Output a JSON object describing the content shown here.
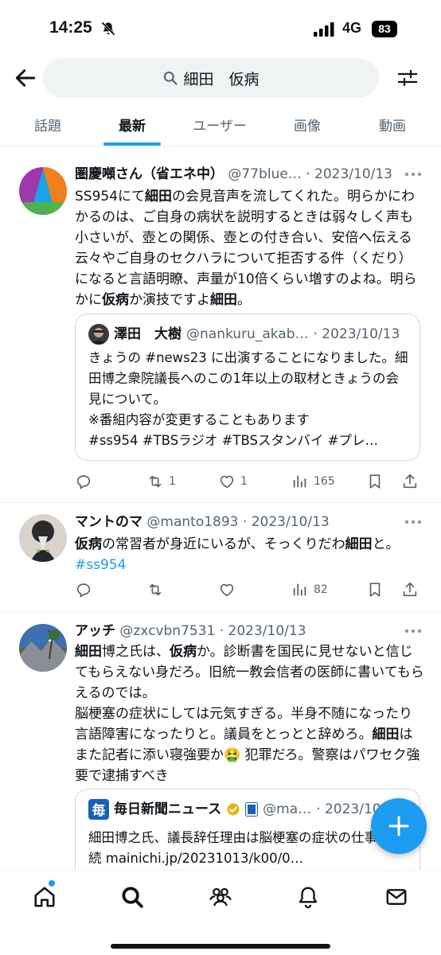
{
  "status": {
    "time": "14:25",
    "network": "4G",
    "battery": "83"
  },
  "search": {
    "query": "細田　仮病"
  },
  "tabs": [
    {
      "label": "話題"
    },
    {
      "label": "最新"
    },
    {
      "label": "ユーザー"
    },
    {
      "label": "画像"
    },
    {
      "label": "動画"
    }
  ],
  "tweets": [
    {
      "name": "圏慶噸さん（省エネ中）",
      "handle": "@77blue…",
      "date": "· 2023/10/13",
      "text_parts": [
        "SS954にて",
        "細田",
        "の会見音声を流してくれた。明らかにわかるのは、ご自身の病状を説明するときは弱々しく声も小さいが、壺との関係、壺との付き合い、安倍へ伝える云々やご自身のセクハラについて拒否する件（くだり）になると言語明瞭、声量が10倍くらい増すのよね。明らかに",
        "仮病",
        "か演技ですよ",
        "細田",
        "。"
      ],
      "quote": {
        "name": "澤田　大樹",
        "handle": "@nankuru_akab…",
        "date": "· 2023/10/13",
        "text": "きょうの #news23 に出演することになりました。細田博之衆院議長へのこの1年以上の取材ときょうの会見について。\n※番組内容が変更することもあります\n#ss954 #TBSラジオ #TBSスタンバイ #プレ…"
      },
      "actions": {
        "reply": "",
        "retweet": "1",
        "like": "1",
        "views": "165"
      }
    },
    {
      "name": "マントのマ",
      "handle": "@manto1893",
      "date": "· 2023/10/13",
      "text_parts": [
        "仮病",
        "の常習者が身近にいるが、そっくりだわ",
        "細田",
        "と。",
        "#ss954"
      ],
      "actions": {
        "reply": "",
        "retweet": "",
        "like": "",
        "views": "82"
      }
    },
    {
      "name": "アッチ",
      "handle": "@zxcvbn7531",
      "date": "· 2023/10/13",
      "text_parts": [
        "細田",
        "博之氏は、",
        "仮病",
        "か。診断書を国民に見せないと信じてもらえない身だろ。旧統一教会信者の医師に書いてもらえるのでは。\n脳梗塞の症状にしては元気すぎる。半身不随になったり言語障害になったりと。議員をとっとと辞めろ。",
        "細田",
        "はまた記者に添い寝強要か",
        "🤮",
        " 犯罪だろ。警察はパワセク強要で逮捕すべき"
      ],
      "quote": {
        "name": "毎日新聞ニュース",
        "handle": "@ma…",
        "date": "· 2023/10/1",
        "text": "細田博之氏、議長辞任理由は脳梗塞の症状の仕事は継続 mainichi.jp/20231013/k00/0…"
      }
    }
  ],
  "colors": {
    "accent": "#1d9bf0",
    "text_primary": "#0f1419",
    "text_secondary": "#536471",
    "search_bg": "#eff3f4"
  },
  "icons": [
    "bell-muted-icon",
    "signal-icon",
    "back-arrow-icon",
    "search-icon",
    "filter-icon",
    "more-icon",
    "reply-icon",
    "retweet-icon",
    "like-icon",
    "views-icon",
    "bookmark-icon",
    "share-icon",
    "verified-icon",
    "compose-plus-icon",
    "home-icon",
    "explore-icon",
    "communities-icon",
    "notifications-icon",
    "messages-icon"
  ]
}
